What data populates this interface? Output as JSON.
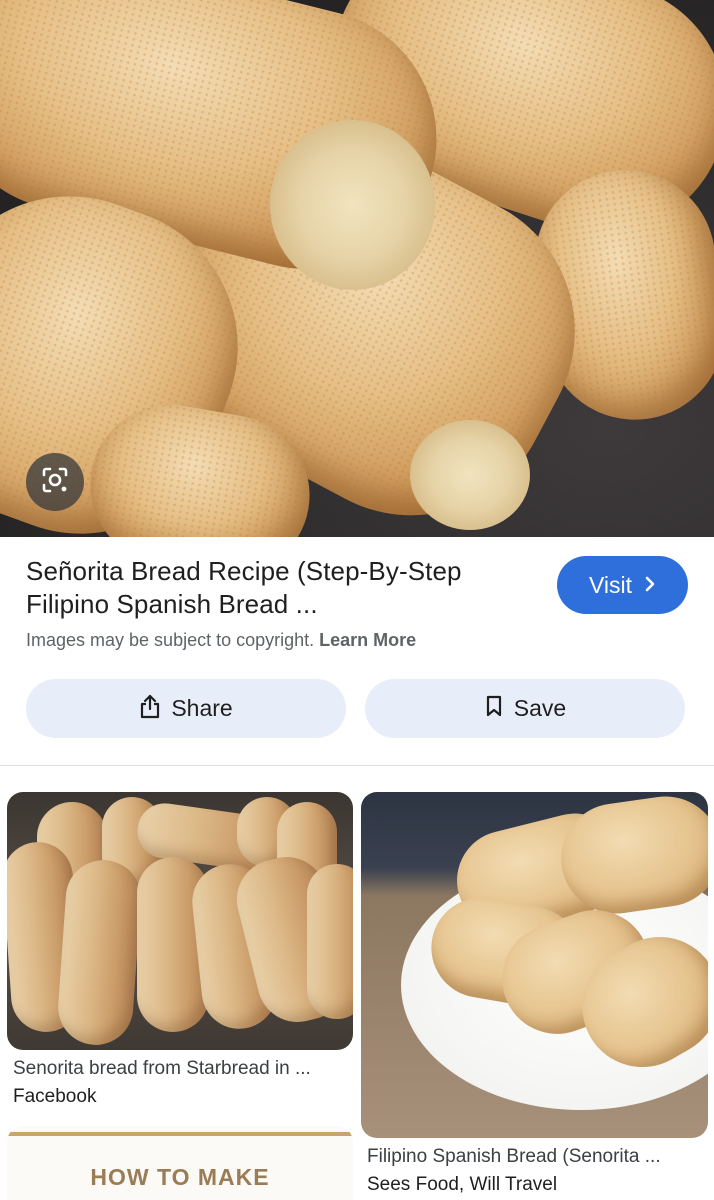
{
  "result": {
    "title": "Señorita Bread Recipe (Step-By-Step Filipino Spanish Bread ...",
    "visit_label": "Visit",
    "copyright_text": "Images may be subject to copyright.",
    "learn_more_label": "Learn More",
    "share_label": "Share",
    "save_label": "Save"
  },
  "related": [
    {
      "title": "Senorita bread from Starbread in ...",
      "source": "Facebook"
    },
    {
      "title": "Filipino Spanish Bread (Senorita ...",
      "source": "Sees Food, Will Travel"
    },
    {
      "overlay_text": "HOW TO MAKE"
    }
  ],
  "icons": {
    "lens": "google-lens-icon",
    "visit_arrow": "chevron-right-icon",
    "share": "share-icon",
    "save": "bookmark-icon"
  },
  "colors": {
    "accent": "#2f6fdc",
    "pill_bg": "#e8eef9",
    "muted_text": "#5f6368"
  }
}
